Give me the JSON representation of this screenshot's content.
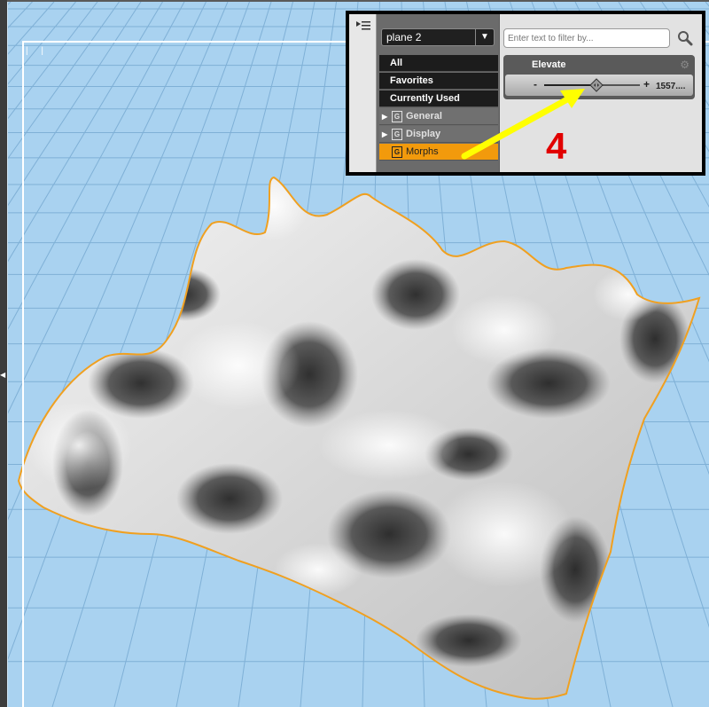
{
  "panel": {
    "node_selector": {
      "value": "plane 2"
    },
    "categories": [
      {
        "label": "All",
        "kind": "plain"
      },
      {
        "label": "Favorites",
        "kind": "plain"
      },
      {
        "label": "Currently Used",
        "kind": "plain"
      },
      {
        "label": "General",
        "kind": "group",
        "expandable": true
      },
      {
        "label": "Display",
        "kind": "group",
        "expandable": true
      },
      {
        "label": "Morphs",
        "kind": "selected",
        "expandable": false
      }
    ],
    "filter": {
      "placeholder": "Enter text to filter by..."
    },
    "parameter": {
      "name": "Elevate",
      "value_text": "1557....",
      "slider_fraction": 0.55,
      "minus_label": "-",
      "plus_label": "+"
    }
  },
  "annotation": {
    "step_number": "4",
    "arrow_color": "#ffff00",
    "number_color": "#e10000"
  },
  "viewport": {
    "background_color": "#a9d2f0",
    "grid_color": "#7fb0d6",
    "selection_outline_color": "#f0a020",
    "corner_label": "| |"
  },
  "icons": [
    "panel-menu-icon",
    "search-icon",
    "gear-icon",
    "expand-triangle-icon",
    "group-icon",
    "slider-knob-icon"
  ]
}
